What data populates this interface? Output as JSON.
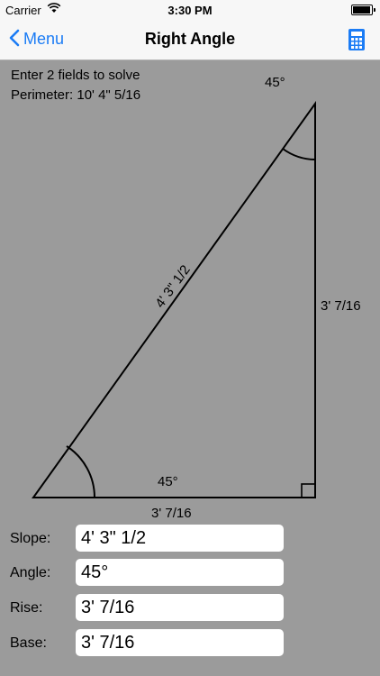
{
  "status_bar": {
    "carrier": "Carrier",
    "time": "3:30 PM",
    "battery_level": 0.95
  },
  "nav": {
    "back_label": "Menu",
    "title": "Right Angle",
    "calculator_icon": "calculator-icon"
  },
  "info": {
    "instruction": "Enter 2 fields to solve",
    "perimeter": "Perimeter: 10' 4\" 5/16"
  },
  "diagram": {
    "top_angle": "45°",
    "bottom_angle": "45°",
    "hypotenuse": "4' 3\" 1/2",
    "rise": "3' 7/16",
    "base": "3' 7/16"
  },
  "form": {
    "slope": {
      "label": "Slope:",
      "value": "4' 3\" 1/2"
    },
    "angle": {
      "label": "Angle:",
      "value": "45°"
    },
    "rise": {
      "label": "Rise:",
      "value": "3' 7/16"
    },
    "base": {
      "label": "Base:",
      "value": "3' 7/16"
    }
  },
  "colors": {
    "accent": "#1b7cf5",
    "background": "#9b9b9b"
  }
}
